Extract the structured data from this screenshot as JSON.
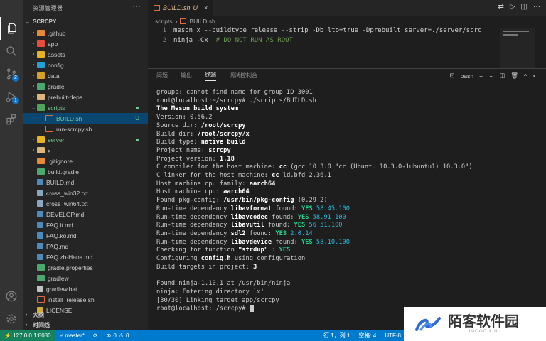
{
  "colors": {
    "accent": "#007acc",
    "remote": "#16825d",
    "untracked": "#73c991",
    "modified": "#e2c08d"
  },
  "sidebar": {
    "header": "资源管理器",
    "project": "SCRCPY",
    "items": [
      {
        "label": ".github",
        "icon": "folder-icon",
        "chev": "›",
        "status": ""
      },
      {
        "label": "app",
        "icon": "folder-icon",
        "chev": "›",
        "status": ""
      },
      {
        "label": "assets",
        "icon": "folder-icon",
        "chev": "›",
        "status": ""
      },
      {
        "label": "config",
        "icon": "folder-icon",
        "chev": "›",
        "status": ""
      },
      {
        "label": "data",
        "icon": "folder-icon",
        "chev": "›",
        "status": ""
      },
      {
        "label": "gradle",
        "icon": "folder-icon",
        "chev": "›",
        "status": ""
      },
      {
        "label": "prebuilt-deps",
        "icon": "folder-icon",
        "chev": "›",
        "status": ""
      },
      {
        "label": "scripts",
        "icon": "folder-icon",
        "chev": "⌄",
        "status": "dot"
      },
      {
        "label": "BUILD.sh",
        "icon": "shell-file-icon",
        "chev": "",
        "status": "U"
      },
      {
        "label": "run-scrcpy.sh",
        "icon": "shell-file-icon",
        "chev": "",
        "status": ""
      },
      {
        "label": "server",
        "icon": "folder-icon",
        "chev": "›",
        "status": "dot"
      },
      {
        "label": "x",
        "icon": "folder-icon",
        "chev": "›",
        "status": ""
      },
      {
        "label": ".gitignore",
        "icon": "git-file-icon",
        "chev": "",
        "status": ""
      },
      {
        "label": "build.gradle",
        "icon": "gradle-file-icon",
        "chev": "",
        "status": ""
      },
      {
        "label": "BUILD.md",
        "icon": "markdown-file-icon",
        "chev": "",
        "status": ""
      },
      {
        "label": "cross_win32.txt",
        "icon": "text-file-icon",
        "chev": "",
        "status": ""
      },
      {
        "label": "cross_win64.txt",
        "icon": "text-file-icon",
        "chev": "",
        "status": ""
      },
      {
        "label": "DEVELOP.md",
        "icon": "markdown-file-icon",
        "chev": "",
        "status": ""
      },
      {
        "label": "FAQ.it.md",
        "icon": "markdown-file-icon",
        "chev": "",
        "status": ""
      },
      {
        "label": "FAQ.ko.md",
        "icon": "markdown-file-icon",
        "chev": "",
        "status": ""
      },
      {
        "label": "FAQ.md",
        "icon": "markdown-file-icon",
        "chev": "",
        "status": ""
      },
      {
        "label": "FAQ.zh-Hans.md",
        "icon": "markdown-file-icon",
        "chev": "",
        "status": ""
      },
      {
        "label": "gradle.properties",
        "icon": "gradle-file-icon",
        "chev": "",
        "status": ""
      },
      {
        "label": "gradlew",
        "icon": "gradle-file-icon",
        "chev": "",
        "status": ""
      },
      {
        "label": "gradlew.bat",
        "icon": "batch-file-icon",
        "chev": "",
        "status": ""
      },
      {
        "label": "install_release.sh",
        "icon": "shell-file-icon",
        "chev": "",
        "status": ""
      },
      {
        "label": "LICENSE",
        "icon": "license-file-icon",
        "chev": "",
        "status": ""
      }
    ],
    "outline": "大纲",
    "timeline": "时间线"
  },
  "editor": {
    "tab_label": "BUILD.sh",
    "tab_status": "U",
    "breadcrumb": [
      "scripts",
      "BUILD.sh"
    ],
    "lines": [
      {
        "num": "1",
        "code": "meson x --buildtype release --strip -Db_lto=true -Dprebuilt_server=./server/scrc",
        "comment": ""
      },
      {
        "num": "2",
        "code": "ninja -Cx  ",
        "comment": "# DO NOT RUN AS ROOT"
      }
    ]
  },
  "panel": {
    "tabs": [
      "问题",
      "输出",
      "终端",
      "调试控制台"
    ],
    "active_tab": "终端",
    "shell": "bash"
  },
  "terminal": {
    "lines": [
      [
        {
          "t": "groups: cannot find name for group ID 3001"
        }
      ],
      [
        {
          "t": "root@localhost:~/scrcpy# ./scripts/BUILD.sh"
        }
      ],
      [
        {
          "t": "The Meson build system",
          "s": "b"
        }
      ],
      [
        {
          "t": "Version: 0.56.2"
        }
      ],
      [
        {
          "t": "Source dir: "
        },
        {
          "t": "/root/scrcpy",
          "s": "b"
        }
      ],
      [
        {
          "t": "Build dir: "
        },
        {
          "t": "/root/scrcpy/x",
          "s": "b"
        }
      ],
      [
        {
          "t": "Build type: "
        },
        {
          "t": "native build",
          "s": "b"
        }
      ],
      [
        {
          "t": "Project name: "
        },
        {
          "t": "scrcpy",
          "s": "b"
        }
      ],
      [
        {
          "t": "Project version: "
        },
        {
          "t": "1.18",
          "s": "b"
        }
      ],
      [
        {
          "t": "C compiler for the host machine: "
        },
        {
          "t": "cc",
          "s": "b"
        },
        {
          "t": " (gcc 10.3.0 \"cc (Ubuntu 10.3.0-1ubuntu1) 10.3.0\")"
        }
      ],
      [
        {
          "t": "C linker for the host machine: "
        },
        {
          "t": "cc",
          "s": "b"
        },
        {
          "t": " ld.bfd 2.36.1"
        }
      ],
      [
        {
          "t": "Host machine cpu family: "
        },
        {
          "t": "aarch64",
          "s": "b"
        }
      ],
      [
        {
          "t": "Host machine cpu: "
        },
        {
          "t": "aarch64",
          "s": "b"
        }
      ],
      [
        {
          "t": "Found pkg-config: "
        },
        {
          "t": "/usr/bin/pkg-config",
          "s": "b"
        },
        {
          "t": " (0.29.2)"
        }
      ],
      [
        {
          "t": "Run-time dependency "
        },
        {
          "t": "libavformat",
          "s": "b"
        },
        {
          "t": " found: "
        },
        {
          "t": "YES",
          "s": "g"
        },
        {
          "t": " 58.45.100",
          "s": "c"
        }
      ],
      [
        {
          "t": "Run-time dependency "
        },
        {
          "t": "libavcodec",
          "s": "b"
        },
        {
          "t": " found: "
        },
        {
          "t": "YES",
          "s": "g"
        },
        {
          "t": " 58.91.100",
          "s": "c"
        }
      ],
      [
        {
          "t": "Run-time dependency "
        },
        {
          "t": "libavutil",
          "s": "b"
        },
        {
          "t": " found: "
        },
        {
          "t": "YES",
          "s": "g"
        },
        {
          "t": " 56.51.100",
          "s": "c"
        }
      ],
      [
        {
          "t": "Run-time dependency "
        },
        {
          "t": "sdl2",
          "s": "b"
        },
        {
          "t": " found: "
        },
        {
          "t": "YES",
          "s": "g"
        },
        {
          "t": " 2.0.14",
          "s": "c"
        }
      ],
      [
        {
          "t": "Run-time dependency "
        },
        {
          "t": "libavdevice",
          "s": "b"
        },
        {
          "t": " found: "
        },
        {
          "t": "YES",
          "s": "g"
        },
        {
          "t": " 58.10.100",
          "s": "c"
        }
      ],
      [
        {
          "t": "Checking for function "
        },
        {
          "t": "\"strdup\"",
          "s": "b"
        },
        {
          "t": " : "
        },
        {
          "t": "YES",
          "s": "g"
        }
      ],
      [
        {
          "t": "Configuring "
        },
        {
          "t": "config.h",
          "s": "b"
        },
        {
          "t": " using configuration"
        }
      ],
      [
        {
          "t": "Build targets in project: "
        },
        {
          "t": "3",
          "s": "b"
        }
      ],
      [
        {
          "t": ""
        }
      ],
      [
        {
          "t": "Found ninja-1.10.1 at /usr/bin/ninja"
        }
      ],
      [
        {
          "t": "ninja: Entering directory `x'"
        }
      ],
      [
        {
          "t": "[30/30] Linking target app/scrcpy"
        }
      ],
      [
        {
          "t": "root@localhost:~/scrcpy# "
        },
        {
          "t": "",
          "s": "cursor"
        }
      ]
    ]
  },
  "status": {
    "remote": "127.0.0.1:8080",
    "branch": "master*",
    "errors": "0",
    "warnings": "0",
    "position": "行 1，列 1",
    "spaces": "空格: 4",
    "encoding": "UTF-8"
  },
  "watermark": {
    "name": "陌客软件园",
    "url": "IMOOC.XIN"
  }
}
